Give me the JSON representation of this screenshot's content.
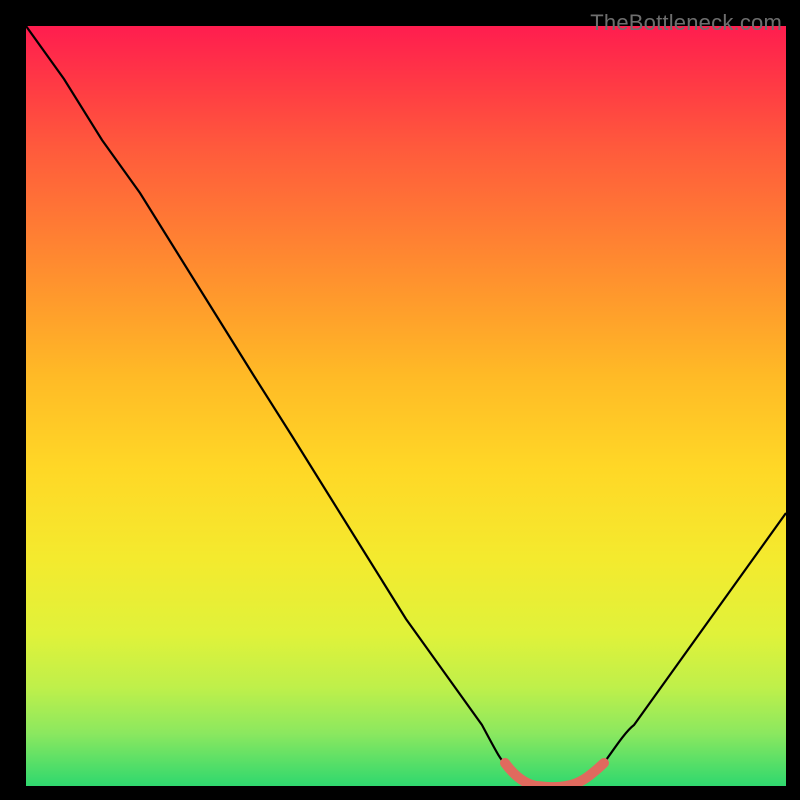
{
  "watermark": {
    "text": "TheBottleneck.com"
  },
  "chart_data": {
    "type": "line",
    "title": "",
    "xlabel": "",
    "ylabel": "",
    "xlim": [
      0,
      100
    ],
    "ylim": [
      0,
      100
    ],
    "background_gradient": [
      "#ff1d4f",
      "#2fd86e"
    ],
    "series": [
      {
        "name": "main-curve",
        "x": [
          0,
          5,
          10,
          15,
          20,
          25,
          30,
          35,
          40,
          45,
          50,
          55,
          60,
          63,
          67,
          70,
          73,
          76,
          80,
          85,
          90,
          95,
          100
        ],
        "y": [
          100,
          93,
          85,
          78,
          70,
          62,
          54,
          46,
          38,
          30,
          22,
          15,
          8,
          3,
          1,
          0,
          0,
          1,
          3,
          8,
          15,
          22,
          30
        ]
      },
      {
        "name": "highlight-segment",
        "color": "#e06a5e",
        "x": [
          63,
          67,
          70,
          73,
          76
        ],
        "y": [
          3,
          1,
          0,
          0,
          1
        ]
      }
    ]
  }
}
